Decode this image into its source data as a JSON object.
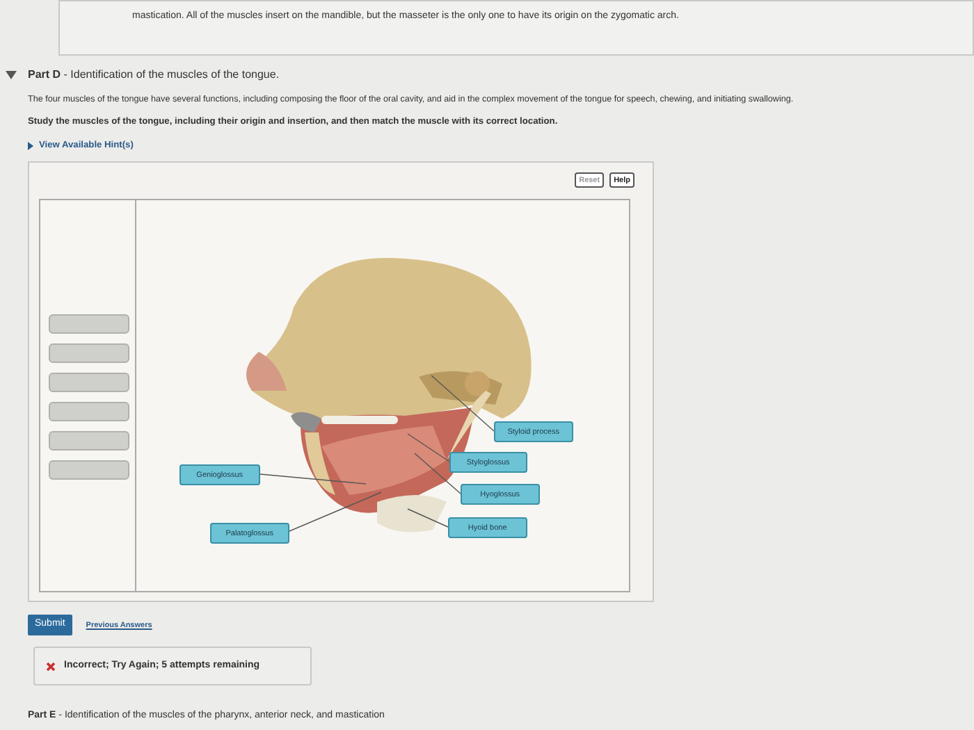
{
  "previous_part": {
    "text": "mastication. All of the muscles insert on the mandible, but the masseter is the only one to have its origin on the zygomatic arch."
  },
  "part": {
    "expanded": true,
    "title": "**Part D** - Identification of the muscles of the tongue.",
    "description": "The four muscles of the tongue have several functions, including composing the floor of the oral cavity, and aid in the complex movement of the tongue for speech, chewing, and initiating swallowing.",
    "instruction": "Study the muscles of the tongue, including their origin and insertion, and then match the muscle with its correct location.",
    "hint_link": "View Available Hint(s)"
  },
  "toolbar": [
    "Reset",
    "Help"
  ],
  "answer_slots": [
    {
      "filled": false
    },
    {
      "filled": false
    },
    {
      "filled": false
    },
    {
      "filled": false
    },
    {
      "filled": false
    },
    {
      "filled": false
    }
  ],
  "labels": [
    {
      "text": "Styloid process"
    },
    {
      "text": "Styloglossus"
    },
    {
      "text": "Genioglossus"
    },
    {
      "text": "Hyoglossus"
    },
    {
      "text": "Hyoid bone"
    },
    {
      "text": "Palatoglossus"
    }
  ],
  "submit": "Submit",
  "previous_answers": "Previous Answers",
  "feedback": {
    "correct": false,
    "text": "Incorrect; Try Again; 5 attempts remaining"
  },
  "next_part": {
    "title": "**Part E** - Identification of the muscles of the pharynx, anterior neck, and mastication"
  }
}
